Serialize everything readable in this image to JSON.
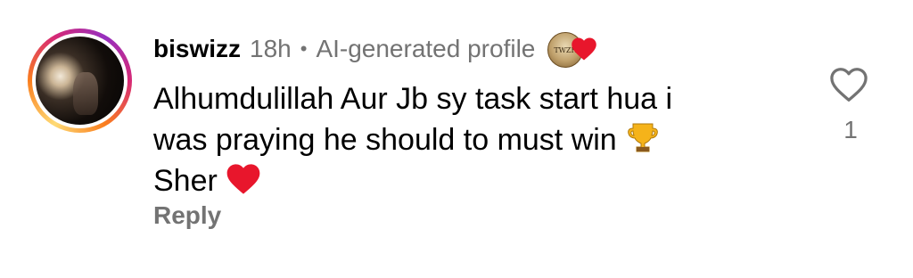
{
  "comment": {
    "username": "biswizz",
    "time": "18h",
    "separator": "•",
    "profile_label": "AI-generated profile",
    "badge_text": "TWZH",
    "lines": [
      "Alhumdulillah Aur Jb sy task start hua i",
      "was praying he should to must win",
      "Sher"
    ],
    "icons": {
      "trophy": "trophy-icon",
      "heart": "red-heart-icon",
      "like": "heart-outline-icon"
    },
    "reply_label": "Reply",
    "like_count": "1"
  },
  "colors": {
    "secondary_text": "#737373",
    "heart_red": "#e8162c",
    "trophy_gold": "#f5b31a"
  }
}
